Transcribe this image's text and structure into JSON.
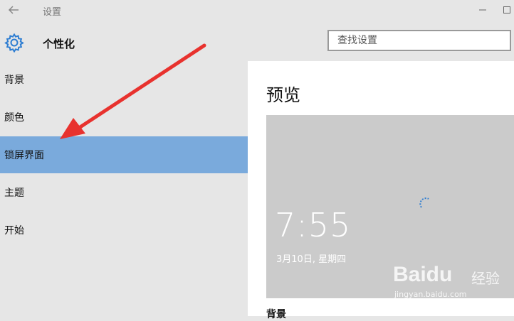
{
  "window": {
    "title": "设置"
  },
  "header": {
    "page_title": "个性化",
    "search_placeholder": "查找设置"
  },
  "sidebar": {
    "items": [
      {
        "label": "背景"
      },
      {
        "label": "颜色"
      },
      {
        "label": "锁屏界面",
        "selected": true
      },
      {
        "label": "主题"
      },
      {
        "label": "开始"
      }
    ]
  },
  "content": {
    "preview_title": "预览",
    "lock_time": "7:55",
    "lock_date": "3月10日, 星期四",
    "next_section": "背景"
  },
  "watermark": {
    "brand": "Baidu",
    "brand_cn": "经验",
    "url": "jingyan.baidu.com"
  },
  "colors": {
    "selected_bg": "#7aaadc",
    "arrow": "#e8322e",
    "accent": "#2d7dd2"
  },
  "icons": [
    "back-arrow-icon",
    "minimize-icon",
    "gear-icon",
    "spinner-icon"
  ]
}
